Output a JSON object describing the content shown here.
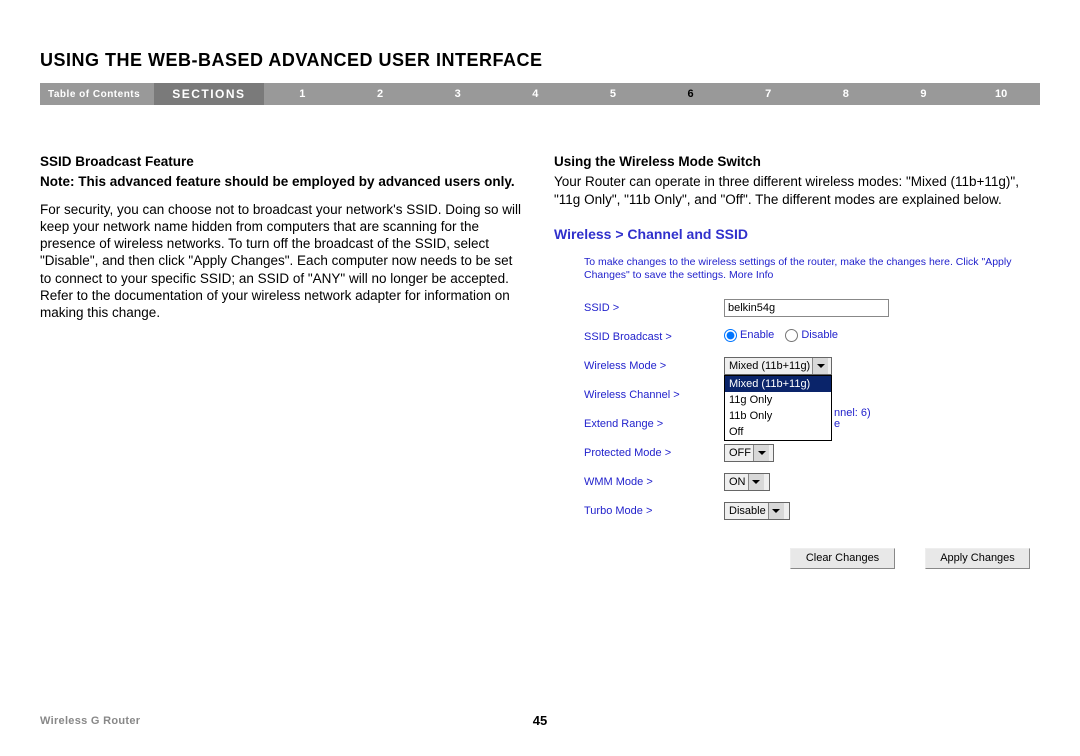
{
  "page": {
    "title": "USING THE WEB-BASED ADVANCED USER INTERFACE",
    "footer_left": "Wireless G Router",
    "page_number": "45"
  },
  "nav": {
    "toc": "Table of Contents",
    "sections": "SECTIONS",
    "numbers": [
      "1",
      "2",
      "3",
      "4",
      "5",
      "6",
      "7",
      "8",
      "9",
      "10"
    ],
    "active": "6"
  },
  "left": {
    "heading": "SSID Broadcast Feature",
    "note": "Note: This advanced feature should be employed by advanced users only.",
    "body": "For security, you can choose not to broadcast your network's SSID. Doing so will keep your network name hidden from computers that are scanning for the presence of wireless networks. To turn off the broadcast of the SSID, select \"Disable\", and then click \"Apply Changes\". Each computer now needs to be set to connect to your specific SSID; an SSID of \"ANY\" will no longer be accepted. Refer to the documentation of your wireless network adapter for information on making this change."
  },
  "right": {
    "heading": "Using the Wireless Mode Switch",
    "body": "Your Router can operate in three different wireless modes: \"Mixed (11b+11g)\", \"11g Only\", \"11b Only\", and \"Off\". The different modes are explained below.",
    "ui_title": "Wireless > Channel and SSID",
    "ui_instr": "To make changes to the wireless settings of the router, make the changes here. Click \"Apply Changes\" to save the settings. More Info",
    "labels": {
      "ssid": "SSID >",
      "broadcast": "SSID Broadcast >",
      "mode": "Wireless Mode >",
      "channel": "Wireless Channel >",
      "extend": "Extend Range >",
      "protected": "Protected Mode >",
      "wmm": "WMM Mode >",
      "turbo": "Turbo Mode >"
    },
    "values": {
      "ssid": "belkin54g",
      "broadcast_enable": "Enable",
      "broadcast_disable": "Disable",
      "mode_selected": "Mixed (11b+11g)",
      "mode_options": [
        "Mixed (11b+11g)",
        "11g Only",
        "11b Only",
        "Off"
      ],
      "channel_hint": "nnel: 6)",
      "extend_hint": "e",
      "protected": "OFF",
      "wmm": "ON",
      "turbo": "Disable"
    },
    "buttons": {
      "clear": "Clear Changes",
      "apply": "Apply Changes"
    }
  }
}
